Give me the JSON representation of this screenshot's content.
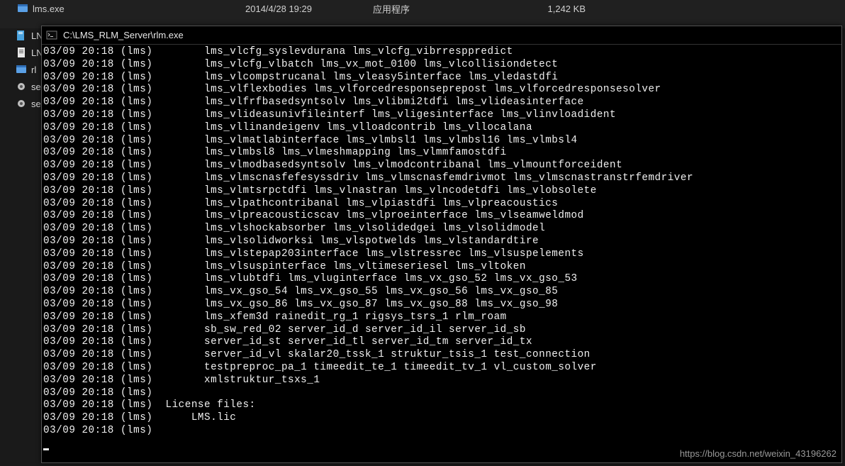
{
  "explorer_row": {
    "name": "lms.exe",
    "date": "2014/4/28 19:29",
    "type": "应用程序",
    "size": "1,242 KB"
  },
  "sidebar_items": [
    {
      "label": "LN",
      "icon": "file"
    },
    {
      "label": "LN",
      "icon": "file-txt"
    },
    {
      "label": "rl",
      "icon": "exe"
    },
    {
      "label": "se",
      "icon": "gear"
    },
    {
      "label": "se",
      "icon": "gear"
    }
  ],
  "console": {
    "title": "C:\\LMS_RLM_Server\\rlm.exe",
    "lines": [
      {
        "ts": "03/09 20:18 (lms)",
        "txt": "       lms_vlcfg_syslevdurana lms_vlcfg_vibrresppredict"
      },
      {
        "ts": "03/09 20:18 (lms)",
        "txt": "       lms_vlcfg_vlbatch lms_vx_mot_0100 lms_vlcollisiondetect"
      },
      {
        "ts": "03/09 20:18 (lms)",
        "txt": "       lms_vlcompstrucanal lms_vleasy5interface lms_vledastdfi"
      },
      {
        "ts": "03/09 20:18 (lms)",
        "txt": "       lms_vlflexbodies lms_vlforcedresponseprepost lms_vlforcedresponsesolver"
      },
      {
        "ts": "03/09 20:18 (lms)",
        "txt": "       lms_vlfrfbasedsyntsolv lms_vlibmi2tdfi lms_vlideasinterface"
      },
      {
        "ts": "03/09 20:18 (lms)",
        "txt": "       lms_vlideasunivfileinterf lms_vligesinterface lms_vlinvloadident"
      },
      {
        "ts": "03/09 20:18 (lms)",
        "txt": "       lms_vllinandeigenv lms_vlloadcontrib lms_vllocalana"
      },
      {
        "ts": "03/09 20:18 (lms)",
        "txt": "       lms_vlmatlabinterface lms_vlmbsl1 lms_vlmbsl16 lms_vlmbsl4"
      },
      {
        "ts": "03/09 20:18 (lms)",
        "txt": "       lms_vlmbsl8 lms_vlmeshmapping lms_vlmmfamostdfi"
      },
      {
        "ts": "03/09 20:18 (lms)",
        "txt": "       lms_vlmodbasedsyntsolv lms_vlmodcontribanal lms_vlmountforceident"
      },
      {
        "ts": "03/09 20:18 (lms)",
        "txt": "       lms_vlmscnasfefesyssdriv lms_vlmscnasfemdrivmot lms_vlmscnastranstrfemdriver"
      },
      {
        "ts": "03/09 20:18 (lms)",
        "txt": "       lms_vlmtsrpctdfi lms_vlnastran lms_vlncodetdfi lms_vlobsolete"
      },
      {
        "ts": "03/09 20:18 (lms)",
        "txt": "       lms_vlpathcontribanal lms_vlpiastdfi lms_vlpreacoustics"
      },
      {
        "ts": "03/09 20:18 (lms)",
        "txt": "       lms_vlpreacousticscav lms_vlproeinterface lms_vlseamweldmod"
      },
      {
        "ts": "03/09 20:18 (lms)",
        "txt": "       lms_vlshockabsorber lms_vlsolidedgei lms_vlsolidmodel"
      },
      {
        "ts": "03/09 20:18 (lms)",
        "txt": "       lms_vlsolidworksi lms_vlspotwelds lms_vlstandardtire"
      },
      {
        "ts": "03/09 20:18 (lms)",
        "txt": "       lms_vlstepap203interface lms_vlstressrec lms_vlsuspelements"
      },
      {
        "ts": "03/09 20:18 (lms)",
        "txt": "       lms_vlsuspinterface lms_vltimeseriesel lms_vltoken"
      },
      {
        "ts": "03/09 20:18 (lms)",
        "txt": "       lms_vlubtdfi lms_vluginterface lms_vx_gso_52 lms_vx_gso_53"
      },
      {
        "ts": "03/09 20:18 (lms)",
        "txt": "       lms_vx_gso_54 lms_vx_gso_55 lms_vx_gso_56 lms_vx_gso_85"
      },
      {
        "ts": "03/09 20:18 (lms)",
        "txt": "       lms_vx_gso_86 lms_vx_gso_87 lms_vx_gso_88 lms_vx_gso_98"
      },
      {
        "ts": "03/09 20:18 (lms)",
        "txt": "       lms_xfem3d rainedit_rg_1 rigsys_tsrs_1 rlm_roam"
      },
      {
        "ts": "03/09 20:18 (lms)",
        "txt": "       sb_sw_red_02 server_id_d server_id_il server_id_sb"
      },
      {
        "ts": "03/09 20:18 (lms)",
        "txt": "       server_id_st server_id_tl server_id_tm server_id_tx"
      },
      {
        "ts": "03/09 20:18 (lms)",
        "txt": "       server_id_vl skalar20_tssk_1 struktur_tsis_1 test_connection"
      },
      {
        "ts": "03/09 20:18 (lms)",
        "txt": "       testpreproc_pa_1 timeedit_te_1 timeedit_tv_1 vl_custom_solver"
      },
      {
        "ts": "03/09 20:18 (lms)",
        "txt": "       xmlstruktur_tsxs_1"
      },
      {
        "ts": "03/09 20:18 (lms)",
        "txt": ""
      },
      {
        "ts": "03/09 20:18 (lms)",
        "txt": " License files:"
      },
      {
        "ts": "03/09 20:18 (lms)",
        "txt": "     LMS.lic"
      },
      {
        "ts": "03/09 20:18 (lms)",
        "txt": ""
      }
    ]
  },
  "watermark": "https://blog.csdn.net/weixin_43196262"
}
